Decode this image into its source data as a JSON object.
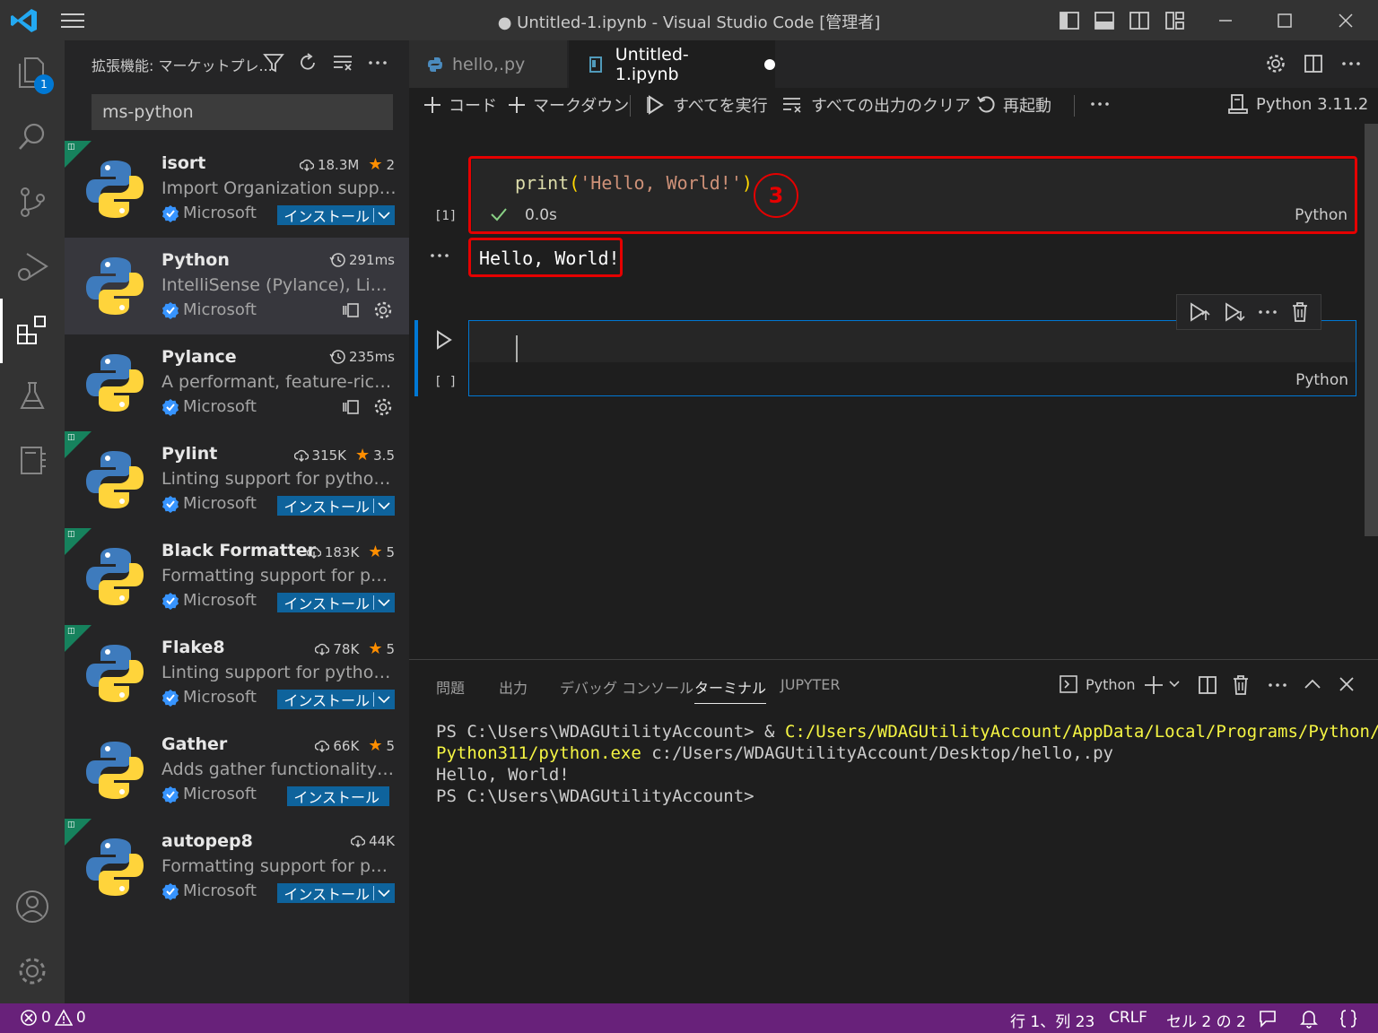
{
  "window": {
    "title": "● Untitled-1.ipynb - Visual Studio Code [管理者]"
  },
  "activity_bar": {
    "explorer_badge": "1"
  },
  "sidebar": {
    "header": "拡張機能: マーケットプレ...",
    "search_value": "ms-python",
    "extensions": [
      {
        "name": "isort",
        "description": "Import Organization suppor...",
        "publisher": "Microsoft",
        "downloads": "18.3M",
        "rating": "2",
        "action": "インストール",
        "recommended": true
      },
      {
        "name": "Python",
        "description": "IntelliSense (Pylance), Lintin...",
        "publisher": "Microsoft",
        "time": "291ms",
        "installed": true
      },
      {
        "name": "Pylance",
        "description": "A performant, feature-rich la...",
        "publisher": "Microsoft",
        "time": "235ms",
        "installed": true
      },
      {
        "name": "Pylint",
        "description": "Linting support for python fi...",
        "publisher": "Microsoft",
        "downloads": "315K",
        "rating": "3.5",
        "action": "インストール",
        "recommended": true
      },
      {
        "name": "Black Formatter",
        "description": "Formatting support for pyth...",
        "publisher": "Microsoft",
        "downloads": "183K",
        "rating": "5",
        "action": "インストール",
        "recommended": true
      },
      {
        "name": "Flake8",
        "description": "Linting support for python fi...",
        "publisher": "Microsoft",
        "downloads": "78K",
        "rating": "5",
        "action": "インストール",
        "recommended": true
      },
      {
        "name": "Gather",
        "description": "Adds gather functionality in ...",
        "publisher": "Microsoft",
        "downloads": "66K",
        "rating": "5",
        "action": "インストール",
        "recommended": false
      },
      {
        "name": "autopep8",
        "description": "Formatting support for pyth...",
        "publisher": "Microsoft",
        "downloads": "44K",
        "action": "インストール",
        "recommended": true
      }
    ]
  },
  "tabs": [
    {
      "label": "hello,.py",
      "active": false
    },
    {
      "label": "Untitled-1.ipynb",
      "active": true,
      "dirty": true
    }
  ],
  "notebook_toolbar": {
    "code": "コード",
    "markdown": "マークダウン",
    "run_all": "すべてを実行",
    "clear_outputs": "すべての出力のクリア",
    "restart": "再起動",
    "kernel": "Python 3.11.2"
  },
  "cells": [
    {
      "exec_count": "[1]",
      "code_print": "print",
      "code_paren_open": "(",
      "code_string": "'Hello, World!'",
      "code_paren_close": ")",
      "duration": "0.0s",
      "language": "Python",
      "output": "Hello, World!",
      "annotation": "3"
    },
    {
      "exec_count": "[ ]",
      "language": "Python"
    }
  ],
  "panel": {
    "tabs": [
      "問題",
      "出力",
      "デバッグ コンソール",
      "ターミナル",
      "JUPYTER"
    ],
    "active_tab": "ターミナル",
    "terminal_name": "Python",
    "terminal_lines": {
      "l1_prompt": "PS C:\\Users\\WDAGUtilityAccount> & ",
      "l1_path": "C:/Users/WDAGUtilityAccount/AppData/Local/Programs/Python/",
      "l2_path": "Python311/python.exe",
      "l2_rest": " c:/Users/WDAGUtilityAccount/Desktop/hello,.py",
      "l3": "Hello, World!",
      "l4": "PS C:\\Users\\WDAGUtilityAccount>"
    }
  },
  "status_bar": {
    "errors": "0",
    "warnings": "0",
    "position": "行 1、列 23",
    "eol": "CRLF",
    "cell": "セル 2 の 2"
  },
  "colors": {
    "accent": "#0078d4",
    "status_bar": "#68217a",
    "annotation_red": "#e50000"
  }
}
